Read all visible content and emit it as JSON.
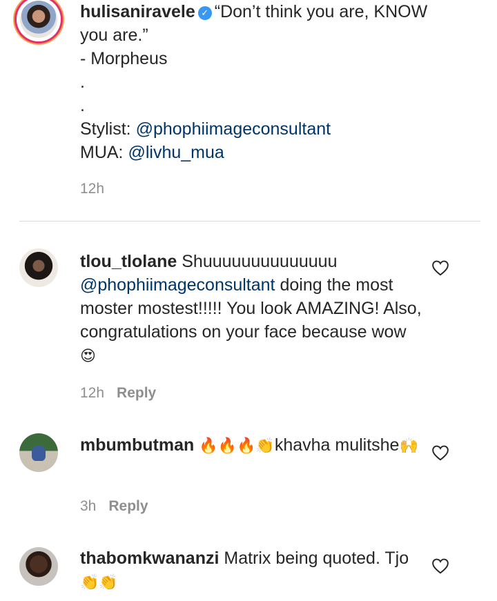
{
  "post": {
    "username": "hulisaniravele",
    "verified_icon": "verified-badge-icon",
    "caption_line1": "“Don’t think you are, KNOW you are.”",
    "caption_line2": "- Morpheus",
    "dot1": ".",
    "dot2": ".",
    "stylist_label": "Stylist: ",
    "stylist_mention": "@phophiimageconsultant",
    "mua_label": "MUA: ",
    "mua_mention": "@livhu_mua",
    "time": "12h"
  },
  "comments": [
    {
      "username": "tlou_tlolane",
      "text_start": "Shuuuuuuuuuuuuuu",
      "mention": "@phophiimageconsultant",
      "text_end": " doing the most moster mostest!!!!! You look AMAZING! Also, congratulations on your face because wow ",
      "emoji": "😍",
      "time": "12h",
      "reply": "Reply"
    },
    {
      "username": "mbumbutman",
      "emoji_fire": "🔥🔥🔥👏",
      "text": "khavha mulitshe",
      "emoji_end": "🙌",
      "time": "3h",
      "reply": "Reply"
    },
    {
      "username": "thabomkwananzi",
      "text": "Matrix being quoted. Tjo ",
      "emoji": "👏👏"
    }
  ],
  "icons": {
    "like": "heart-outline-icon"
  },
  "colors": {
    "mention": "#003569",
    "muted": "#8e8e8e",
    "verified": "#3897f0"
  }
}
